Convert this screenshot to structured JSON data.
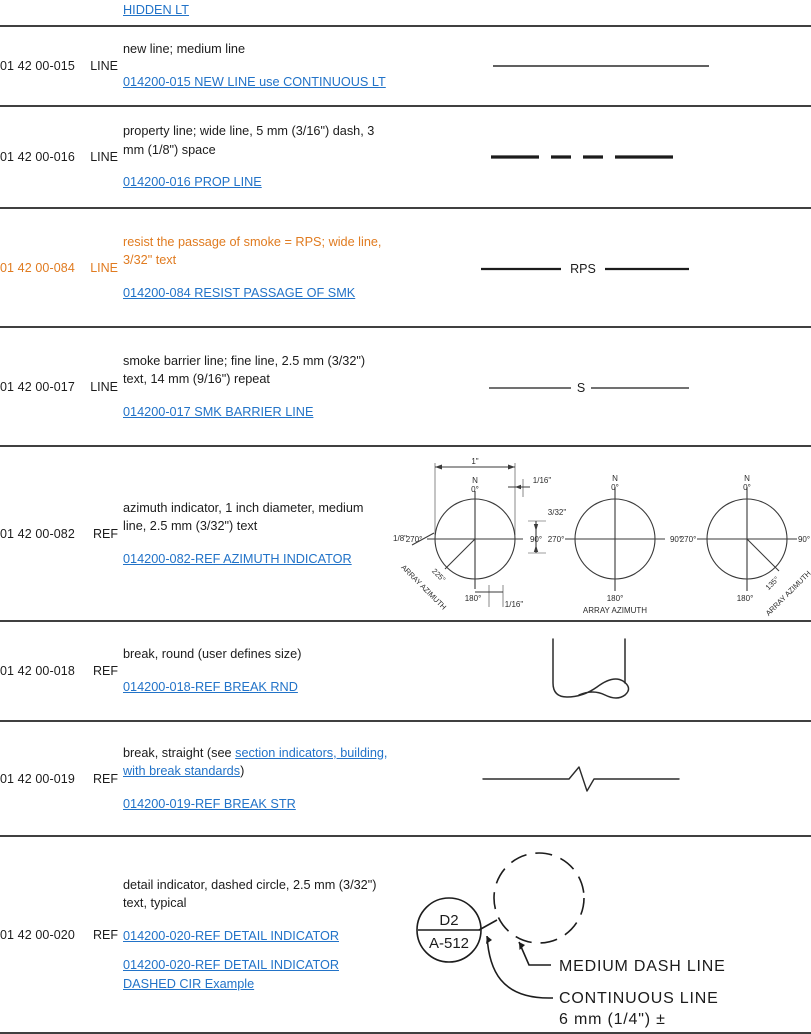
{
  "document": {
    "type": "cad-line-type-standards-table",
    "colors": {
      "link": "#2273c8",
      "highlight_orange": "#e07b20",
      "rule": "#404040",
      "text": "#1c1c1c",
      "graphic_stroke": "#2b2b2b"
    }
  },
  "top_partial_row": {
    "link_label": "HIDDEN LT"
  },
  "rows": [
    {
      "code_number": "01 42 00-015",
      "code_type": "LINE",
      "highlight": false,
      "description": "new line; medium line",
      "links": [
        "014200-015 NEW LINE use CONTINUOUS LT"
      ],
      "graphic": "continuous-line",
      "graphic_caption": ""
    },
    {
      "code_number": "01 42 00-016",
      "code_type": "LINE",
      "highlight": false,
      "description": "property line; wide line, 5 mm (3/16\") dash, 3 mm (1/8\") space",
      "links": [
        "014200-016 PROP LINE"
      ],
      "graphic": "property-dashed-line",
      "graphic_caption": ""
    },
    {
      "code_number": "01 42 00-084",
      "code_type": "LINE",
      "highlight": true,
      "description": "resist the passage of smoke = RPS; wide line, 3/32\" text",
      "links": [
        "014200-084 RESIST PASSAGE OF SMK"
      ],
      "graphic": "rps-labeled-line",
      "graphic_caption": "RPS"
    },
    {
      "code_number": "01 42 00-017",
      "code_type": "LINE",
      "highlight": false,
      "description": "smoke barrier line; fine line, 2.5 mm (3/32\") text, 14 mm (9/16\") repeat",
      "links": [
        "014200-017 SMK BARRIER LINE"
      ],
      "graphic": "smoke-barrier-labeled-line",
      "graphic_caption": "S"
    },
    {
      "code_number": "01 42 00-082",
      "code_type": "REF",
      "highlight": false,
      "description": "azimuth indicator, 1 inch diameter, medium line, 2.5 mm (3/32\") text",
      "links": [
        "014200-082-REF AZIMUTH INDICATOR"
      ],
      "graphic": "azimuth-indicators",
      "graphic_caption": ""
    },
    {
      "code_number": "01 42 00-018",
      "code_type": "REF",
      "highlight": false,
      "description": "break, round (user defines size)",
      "links": [
        "014200-018-REF BREAK RND"
      ],
      "graphic": "break-round",
      "graphic_caption": ""
    },
    {
      "code_number": "01 42 00-019",
      "code_type": "REF",
      "highlight": false,
      "description_parts": {
        "lead": "break, straight (see ",
        "link": "section indicators, building, with break standards",
        "tail": ")"
      },
      "links": [
        "014200-019-REF BREAK STR"
      ],
      "graphic": "break-straight",
      "graphic_caption": ""
    },
    {
      "code_number": "01 42 00-020",
      "code_type": "REF",
      "highlight": false,
      "description": "detail indicator, dashed circle, 2.5 mm (3/32\") text, typical",
      "links": [
        "014200-020-REF DETAIL INDICATOR",
        "014200-020-REF DETAIL INDICATOR DASHED CIR Example"
      ],
      "graphic": "detail-indicator",
      "graphic_caption": ""
    }
  ],
  "azimuth_graphic": {
    "dimension_width": "1\"",
    "dimension_tick_top": "1/16\"",
    "dimension_tick_bottom": "1/16\"",
    "dimension_tick_right": "3/32\"",
    "dimension_tick_left": "1/8\"",
    "circles": [
      {
        "north_label": "N",
        "zero": "0°",
        "east": "90°",
        "west": "270°",
        "south": "180°",
        "azimuth_value": "225°",
        "azimuth_text": "ARRAY AZIMUTH",
        "azimuth_direction": "lower-left",
        "dimensioned": true
      },
      {
        "north_label": "N",
        "zero": "0°",
        "east": "90°",
        "west": "270°",
        "south": "180°",
        "azimuth_value": "",
        "azimuth_text": "ARRAY AZIMUTH",
        "azimuth_direction": "none",
        "dimensioned": false
      },
      {
        "north_label": "N",
        "zero": "0°",
        "east": "90°",
        "west": "270°",
        "south": "180°",
        "azimuth_value": "135°",
        "azimuth_text": "ARRAY AZIMUTH",
        "azimuth_direction": "lower-right",
        "dimensioned": false
      }
    ]
  },
  "detail_indicator_graphic": {
    "bubble_top": "D2",
    "bubble_bottom": "A-512",
    "callout_dash": "MEDIUM DASH LINE",
    "callout_continuous_line1": "CONTINUOUS LINE",
    "callout_continuous_line2": "6 mm (1/4\") ±"
  }
}
